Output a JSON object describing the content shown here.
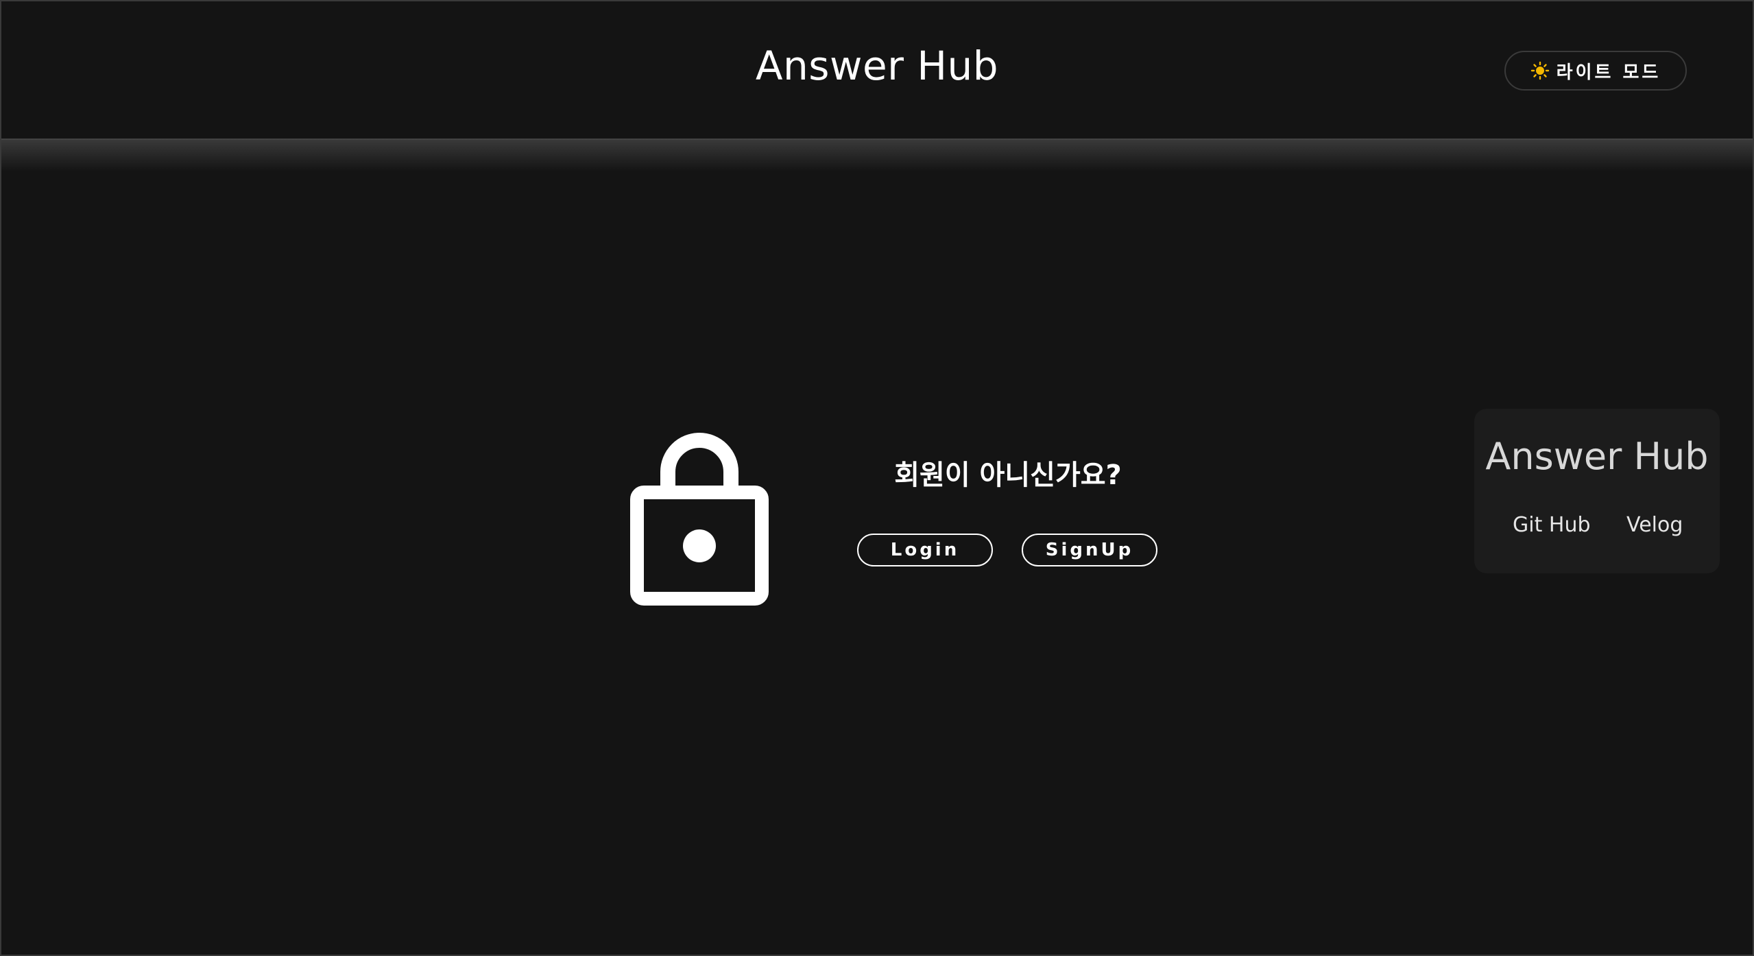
{
  "header": {
    "title": "Answer Hub",
    "theme_toggle_label": "라이트 모드",
    "theme_toggle_icon": "sun-icon"
  },
  "main": {
    "icon": "lock-icon",
    "prompt": "회원이 아니신가요?",
    "login_label": "Login",
    "signup_label": "SignUp"
  },
  "side_card": {
    "title": "Answer Hub",
    "links": [
      "Git Hub",
      "Velog"
    ]
  },
  "colors": {
    "background": "#141414",
    "text": "#ffffff",
    "card": "#1c1c1c",
    "sun": "#f5b800"
  }
}
